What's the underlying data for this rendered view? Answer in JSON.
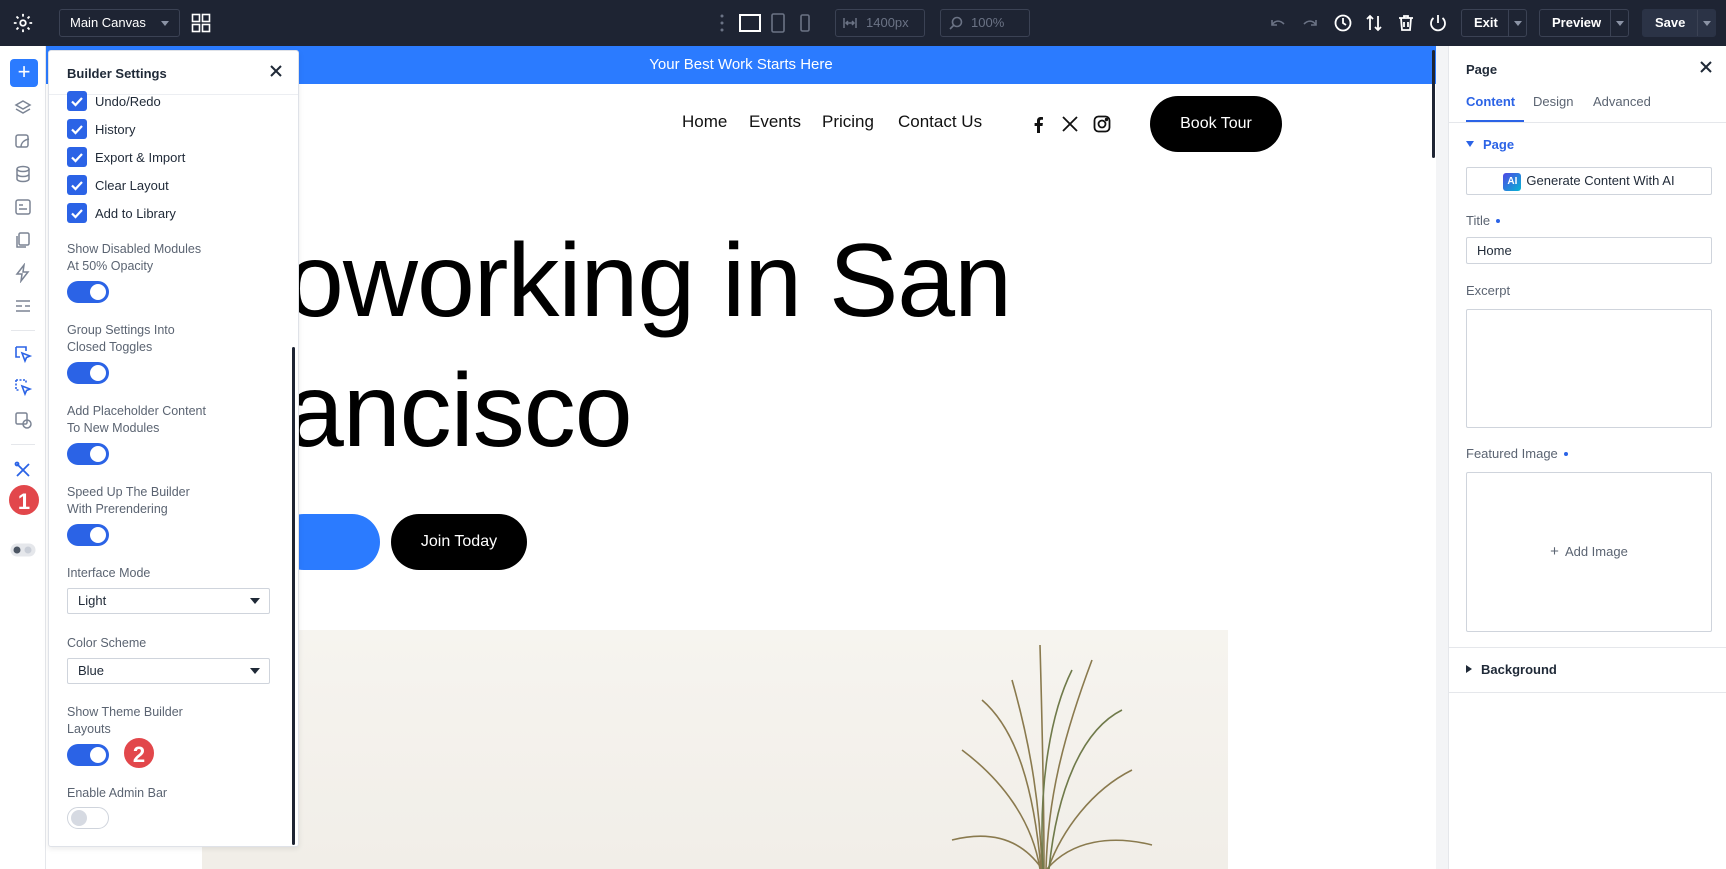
{
  "topbar": {
    "canvas_select": "Main Canvas",
    "width_field": "1400px",
    "zoom_field": "100%",
    "exit_label": "Exit",
    "preview_label": "Preview",
    "save_label": "Save"
  },
  "badges": {
    "one": "1",
    "two": "2"
  },
  "canvas": {
    "promo": "Your Best Work Starts Here",
    "nav": [
      "Home",
      "Events",
      "Pricing",
      "Contact Us"
    ],
    "book_tour": "Book Tour",
    "hero_line1": "oworking in San",
    "hero_line2": "ancisco",
    "join_button": "Join Today"
  },
  "builder_settings": {
    "title": "Builder Settings",
    "checkboxes": [
      "Undo/Redo",
      "History",
      "Export & Import",
      "Clear Layout",
      "Add to Library"
    ],
    "settings": {
      "disabled_modules": {
        "line1": "Show Disabled Modules",
        "line2": "At 50% Opacity",
        "on": true
      },
      "group_settings": {
        "line1": "Group Settings Into",
        "line2": "Closed Toggles",
        "on": true
      },
      "placeholder": {
        "line1": "Add Placeholder Content",
        "line2": "To New Modules",
        "on": true
      },
      "speed_up": {
        "line1": "Speed Up The Builder",
        "line2": "With Prerendering",
        "on": true
      },
      "theme_builder": {
        "line1": "Show Theme Builder",
        "line2": "Layouts",
        "on": true
      },
      "admin_bar": {
        "line1": "Enable Admin Bar",
        "on": false
      }
    },
    "interface_mode": {
      "label": "Interface Mode",
      "value": "Light"
    },
    "color_scheme": {
      "label": "Color Scheme",
      "value": "Blue"
    }
  },
  "page_panel": {
    "title": "Page",
    "tabs": [
      "Content",
      "Design",
      "Advanced"
    ],
    "section_page": "Page",
    "ai_button": "Generate Content With AI",
    "ai_badge": "AI",
    "title_label": "Title",
    "title_value": "Home",
    "excerpt_label": "Excerpt",
    "excerpt_value": "",
    "featured_label": "Featured Image",
    "add_image": "Add Image",
    "section_background": "Background"
  },
  "colors": {
    "accent": "#2b63e6",
    "promo_blue": "#2b7bff",
    "topbar": "#1e2433",
    "badge_red": "#e2474b"
  }
}
